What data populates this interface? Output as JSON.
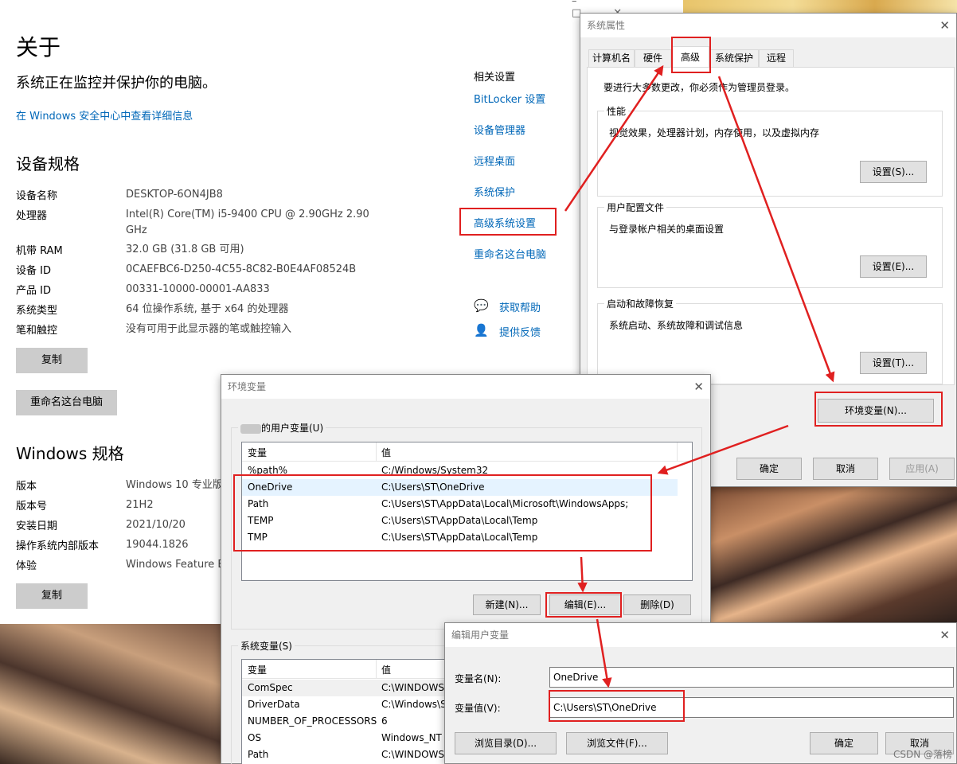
{
  "about": {
    "title": "关于",
    "protect_text": "系统正在监控并保护你的电脑。",
    "security_link": "在 Windows 安全中心中查看详细信息",
    "device_specs_heading": "设备规格",
    "device_specs": [
      {
        "key": "设备名称",
        "value": "DESKTOP-6ON4JB8"
      },
      {
        "key": "处理器",
        "value": "Intel(R) Core(TM) i5-9400 CPU @ 2.90GHz   2.90 GHz"
      },
      {
        "key": "机带 RAM",
        "value": "32.0 GB (31.8 GB 可用)"
      },
      {
        "key": "设备 ID",
        "value": "0CAEFBC6-D250-4C55-8C82-B0E4AF08524B"
      },
      {
        "key": "产品 ID",
        "value": "00331-10000-00001-AA833"
      },
      {
        "key": "系统类型",
        "value": "64 位操作系统, 基于 x64 的处理器"
      },
      {
        "key": "笔和触控",
        "value": "没有可用于此显示器的笔或触控输入"
      }
    ],
    "copy_label": "复制",
    "rename_label": "重命名这台电脑",
    "windows_specs_heading": "Windows 规格",
    "windows_specs": [
      {
        "key": "版本",
        "value": "Windows 10 专业版"
      },
      {
        "key": "版本号",
        "value": "21H2"
      },
      {
        "key": "安装日期",
        "value": "2021/10/20"
      },
      {
        "key": "操作系统内部版本",
        "value": "19044.1826"
      },
      {
        "key": "体验",
        "value": "Windows Feature E"
      }
    ],
    "copy2_label": "复制",
    "related_heading": "相关设置",
    "related_links": [
      "BitLocker 设置",
      "设备管理器",
      "远程桌面",
      "系统保护",
      "高级系统设置",
      "重命名这台电脑"
    ],
    "help_label": "获取帮助",
    "feedback_label": "提供反馈"
  },
  "sysprops": {
    "title": "系统属性",
    "tabs": [
      "计算机名",
      "硬件",
      "高级",
      "系统保护",
      "远程"
    ],
    "admin_note": "要进行大多数更改，你必须作为管理员登录。",
    "perf_label": "性能",
    "perf_desc": "视觉效果，处理器计划，内存使用，以及虚拟内存",
    "perf_btn": "设置(S)...",
    "profile_label": "用户配置文件",
    "profile_desc": "与登录帐户相关的桌面设置",
    "profile_btn": "设置(E)...",
    "startup_label": "启动和故障恢复",
    "startup_desc": "系统启动、系统故障和调试信息",
    "startup_btn": "设置(T)...",
    "env_btn": "环境变量(N)...",
    "ok": "确定",
    "cancel": "取消",
    "apply": "应用(A)"
  },
  "envvars": {
    "title": "环境变量",
    "user_group_label": "的用户变量(U)",
    "col_var": "变量",
    "col_val": "值",
    "user_vars": [
      {
        "name": "%path%",
        "value": "C:/Windows/System32"
      },
      {
        "name": "OneDrive",
        "value": "C:\\Users\\ST\\OneDrive"
      },
      {
        "name": "Path",
        "value": "C:\\Users\\ST\\AppData\\Local\\Microsoft\\WindowsApps;"
      },
      {
        "name": "TEMP",
        "value": "C:\\Users\\ST\\AppData\\Local\\Temp"
      },
      {
        "name": "TMP",
        "value": "C:\\Users\\ST\\AppData\\Local\\Temp"
      }
    ],
    "new_btn": "新建(N)...",
    "edit_btn": "编辑(E)...",
    "delete_btn": "删除(D)",
    "system_group_label": "系统变量(S)",
    "system_vars": [
      {
        "name": "ComSpec",
        "value": "C:\\WINDOWS"
      },
      {
        "name": "DriverData",
        "value": "C:\\Windows\\S"
      },
      {
        "name": "NUMBER_OF_PROCESSORS",
        "value": "6"
      },
      {
        "name": "OS",
        "value": "Windows_NT"
      },
      {
        "name": "Path",
        "value": "C:\\WINDOWS"
      }
    ]
  },
  "editvar": {
    "title": "编辑用户变量",
    "name_label": "变量名(N):",
    "name_value": "OneDrive",
    "value_label": "变量值(V):",
    "value_value": "C:\\Users\\ST\\OneDrive",
    "browse_dir": "浏览目录(D)...",
    "browse_file": "浏览文件(F)...",
    "ok": "确定",
    "cancel": "取消"
  },
  "watermark": "CSDN @落榜"
}
